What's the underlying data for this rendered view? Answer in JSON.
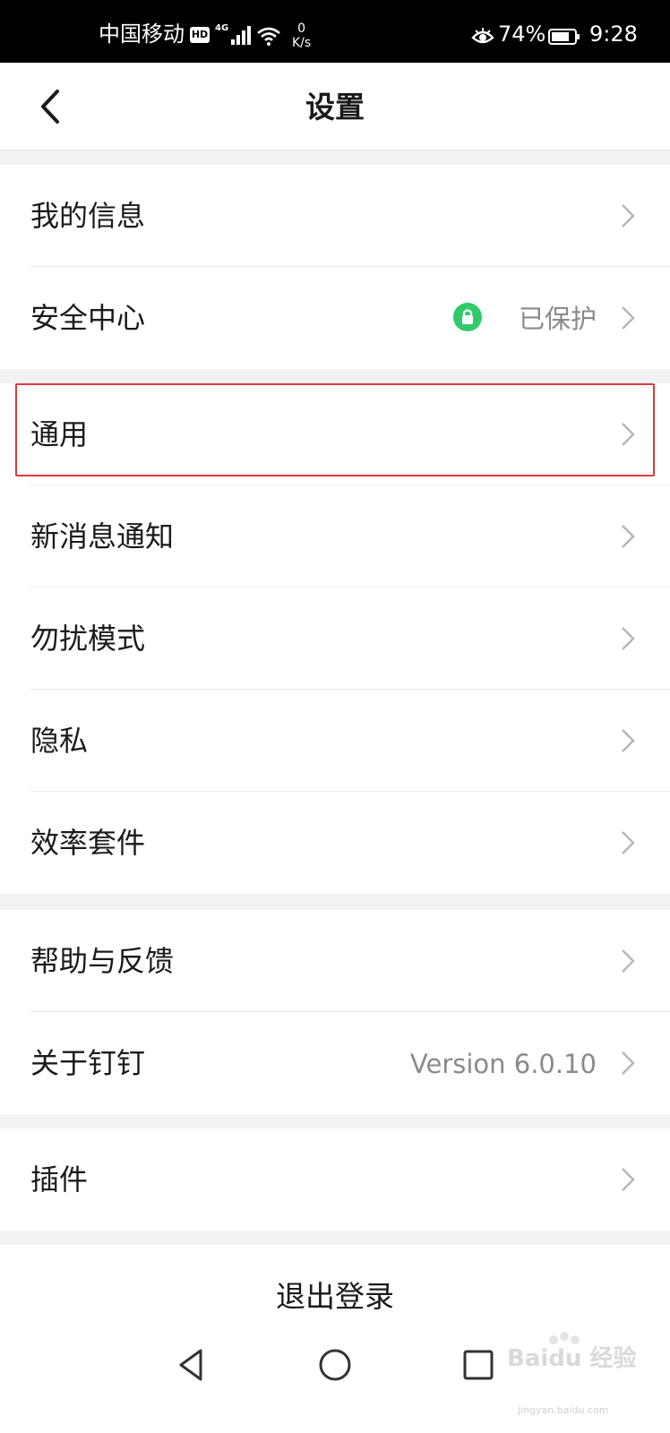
{
  "status_bar": {
    "carrier": "中国移动",
    "hd": "HD",
    "network": "4G",
    "speed_value": "0",
    "speed_unit": "K/s",
    "battery_percent": "74%",
    "time": "9:28"
  },
  "header": {
    "title": "设置"
  },
  "groups": [
    {
      "items": [
        {
          "label": "我的信息"
        },
        {
          "label": "安全中心",
          "value": "已保护",
          "badge_color": "#2fcb6a"
        }
      ]
    },
    {
      "items": [
        {
          "label": "通用",
          "highlighted": true
        },
        {
          "label": "新消息通知"
        },
        {
          "label": "勿扰模式"
        },
        {
          "label": "隐私"
        },
        {
          "label": "效率套件"
        }
      ]
    },
    {
      "items": [
        {
          "label": "帮助与反馈"
        },
        {
          "label": "关于钉钉",
          "value": "Version 6.0.10"
        }
      ]
    },
    {
      "items": [
        {
          "label": "插件"
        }
      ]
    }
  ],
  "logout_label": "退出登录",
  "watermark": {
    "text": "Baidu 经验",
    "sub": "jingyan.baidu.com"
  },
  "colors": {
    "highlight_border": "#e03a3a",
    "badge_green": "#2fcb6a",
    "secondary_text": "#8a8a8a"
  }
}
